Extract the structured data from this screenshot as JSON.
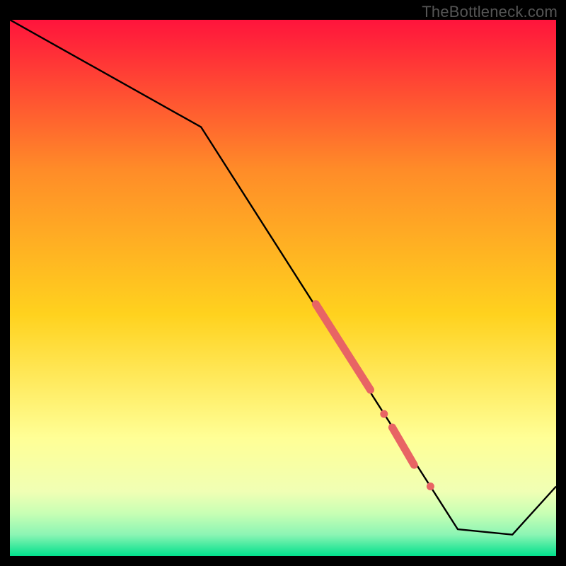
{
  "watermark": "TheBottleneck.com",
  "colors": {
    "gradient_top": "#ff143c",
    "gradient_mid_upper": "#ff8c28",
    "gradient_mid": "#ffd21e",
    "gradient_mid_lower": "#ffff96",
    "gradient_low1": "#f0ffb4",
    "gradient_low2": "#c8ffb4",
    "gradient_low3": "#8cf5b4",
    "gradient_bottom": "#00e08c",
    "line": "#000000",
    "marker": "#e86464"
  },
  "chart_data": {
    "type": "line",
    "title": "",
    "xlabel": "",
    "ylabel": "",
    "xlim": [
      0,
      100
    ],
    "ylim": [
      0,
      100
    ],
    "series": [
      {
        "name": "bottleneck-curve",
        "x": [
          0,
          35,
          82,
          92,
          100
        ],
        "values": [
          100,
          80,
          5,
          4,
          13
        ]
      }
    ],
    "markers": [
      {
        "name": "pink-segment-1",
        "shape": "segment",
        "x1": 56,
        "y1": 47,
        "x2": 66,
        "y2": 31
      },
      {
        "name": "pink-dot-1",
        "shape": "dot",
        "x": 68.5,
        "y": 26.5
      },
      {
        "name": "pink-segment-2",
        "shape": "segment",
        "x1": 70,
        "y1": 24,
        "x2": 74,
        "y2": 17
      },
      {
        "name": "pink-dot-2",
        "shape": "dot",
        "x": 77,
        "y": 13
      }
    ]
  }
}
